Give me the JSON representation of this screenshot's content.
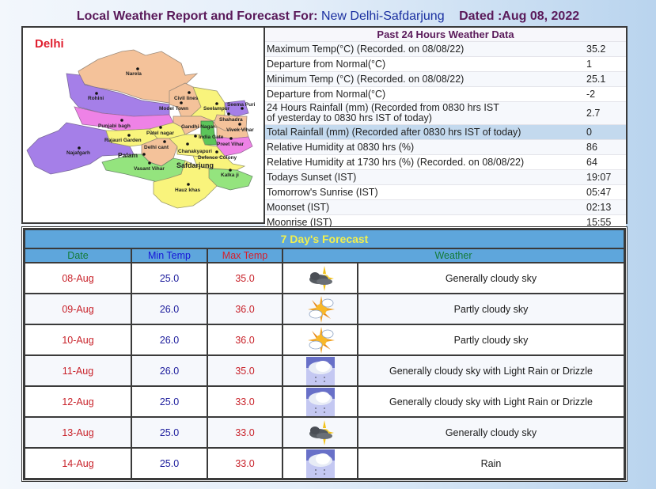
{
  "header": {
    "title_prefix": "Local Weather Report and Forecast For:",
    "station": "New Delhi-Safdarjung",
    "dated": "Dated :Aug 08, 2022"
  },
  "map": {
    "title": "Delhi",
    "districts": [
      "Narela",
      "Rohini",
      "Civil lines",
      "Model Town",
      "Seelampur",
      "Seema Puri",
      "Shahadra",
      "Punjabi bagh",
      "Gandhi Nagar",
      "Vivek Vihar",
      "Patel nagar",
      "India Gate",
      "Preet Vihar",
      "Rajauri Garden",
      "Delhi cant",
      "Chanakyapuri",
      "Najafgarh",
      "Palam",
      "Defence Colony",
      "Vasant Vihar",
      "Safdarjung",
      "Kalka ji",
      "Hauz khas"
    ],
    "colors": {
      "peach": "#f4c29a",
      "purple": "#a57fe8",
      "pink": "#ee82e6",
      "yellow": "#f9f47c",
      "green": "#94e47e",
      "dark_green": "#5cc55a"
    }
  },
  "past24": {
    "title": "Past 24 Hours Weather Data",
    "rows": [
      {
        "label": "Maximum Temp(°C) (Recorded. on 08/08/22)",
        "value": "35.2"
      },
      {
        "label": "Departure from Normal(°C)",
        "value": "1"
      },
      {
        "label": "Minimum Temp (°C) (Recorded. on 08/08/22)",
        "value": "25.1"
      },
      {
        "label": "Departure from Normal(°C)",
        "value": "-2"
      },
      {
        "label": "24 Hours Rainfall (mm) (Recorded from 0830 hrs IST",
        "label2": "of yesterday to 0830 hrs IST of today)",
        "value": "2.7"
      },
      {
        "label": "Total Rainfall (mm) (Recorded after 0830 hrs IST of today)",
        "value": "0"
      },
      {
        "label": "Relative Humidity at 0830 hrs (%)",
        "value": "86"
      },
      {
        "label": "Relative Humidity at 1730 hrs (%) (Recorded. on 08/08/22)",
        "value": "64"
      },
      {
        "label": "Todays Sunset (IST)",
        "value": "19:07"
      },
      {
        "label": "Tomorrow's Sunrise (IST)",
        "value": "05:47"
      },
      {
        "label": "Moonset (IST)",
        "value": "02:13"
      },
      {
        "label": "Moonrise (IST)",
        "value": "15:55"
      }
    ]
  },
  "forecast": {
    "title": "7 Day's Forecast",
    "headers": {
      "date": "Date",
      "min": "Min Temp",
      "max": "Max Temp",
      "weather": "Weather"
    },
    "rows": [
      {
        "date": "08-Aug",
        "min": "25.0",
        "max": "35.0",
        "icon": "cloudy-sun-icon",
        "weather": "Generally cloudy sky"
      },
      {
        "date": "09-Aug",
        "min": "26.0",
        "max": "36.0",
        "icon": "partly-cloudy-icon",
        "weather": "Partly cloudy sky"
      },
      {
        "date": "10-Aug",
        "min": "26.0",
        "max": "36.0",
        "icon": "partly-cloudy-icon",
        "weather": "Partly cloudy sky"
      },
      {
        "date": "11-Aug",
        "min": "26.0",
        "max": "35.0",
        "icon": "light-rain-icon",
        "weather": "Generally cloudy sky with Light Rain or Drizzle"
      },
      {
        "date": "12-Aug",
        "min": "25.0",
        "max": "33.0",
        "icon": "light-rain-icon",
        "weather": "Generally cloudy sky with Light Rain or Drizzle"
      },
      {
        "date": "13-Aug",
        "min": "25.0",
        "max": "33.0",
        "icon": "cloudy-sun-icon",
        "weather": "Generally cloudy sky"
      },
      {
        "date": "14-Aug",
        "min": "25.0",
        "max": "33.0",
        "icon": "light-rain-icon",
        "weather": "Rain"
      }
    ]
  }
}
